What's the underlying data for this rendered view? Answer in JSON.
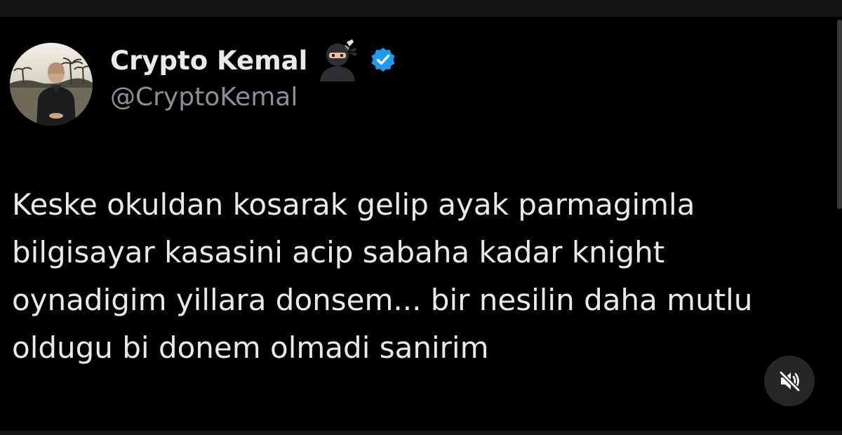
{
  "author": {
    "display_name": "Crypto Kemal",
    "handle": "@CryptoKemal",
    "name_emoji": "ninja",
    "verified": true,
    "verified_color": "#1d9bf0"
  },
  "tweet": {
    "lines": [
      "Keske okuldan kosarak gelip ayak parmagimla",
      "bilgisayar kasasini acip sabaha kadar knight",
      "oynadigim yillara donsem... bir nesilin daha mutlu",
      "oldugu bi donem olmadi sanirim"
    ]
  },
  "controls": {
    "mute_icon": "speaker-muted-icon"
  },
  "colors": {
    "background": "#000000",
    "text": "#e7e9ea",
    "secondary_text": "#8b9096",
    "control_bg": "#262626"
  }
}
